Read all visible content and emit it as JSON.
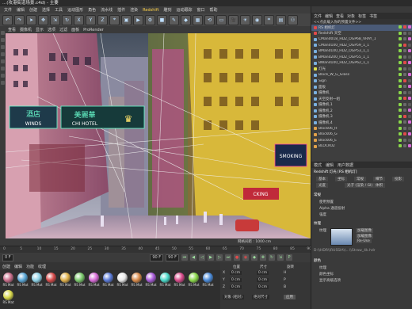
{
  "window": {
    "title": "...(攻港街道场景.c4d) - 主要"
  },
  "menubar": {
    "items": [
      "文件",
      "编辑",
      "创建",
      "选择",
      "工具",
      "运动图形",
      "角色",
      "流水线",
      "插件",
      "渲染",
      "Redshift",
      "雕刻",
      "运动跟踪",
      "窗口",
      "帮助"
    ],
    "highlight_index": 10
  },
  "toolbar": {
    "icons": [
      "undo-icon",
      "redo-icon",
      "select-icon",
      "move-icon",
      "scale-icon",
      "rotate-icon",
      "x-axis-icon",
      "y-axis-icon",
      "z-axis-icon",
      "coord-icon",
      "render-region-icon",
      "render-view-icon",
      "render-settings-icon",
      "cube-icon",
      "pen-icon",
      "subdivision-icon",
      "array-icon",
      "deformer-icon",
      "floor-icon",
      "camera-icon",
      "light-icon",
      "tag-icon",
      "snap-icon",
      "workplane-icon",
      "python-icon"
    ]
  },
  "viewport": {
    "menu": [
      "查看",
      "摄像机",
      "显示",
      "选项",
      "过滤",
      "面板",
      "ProRender"
    ],
    "status": "网格间距 : 1000 cm",
    "signs": {
      "winds": "WINDS",
      "hotel_top": "美麗華",
      "hotel_bottom": "CHI HOTEL",
      "vertical": "酒店",
      "right_sign": "SMOKING",
      "lower_sign": "CKING"
    }
  },
  "timeline": {
    "ticks": [
      "0",
      "5",
      "10",
      "15",
      "20",
      "25",
      "30",
      "35",
      "40",
      "45",
      "50",
      "55",
      "60",
      "65",
      "70",
      "75",
      "80",
      "85",
      "90"
    ],
    "current": "0 F",
    "end": "90 F",
    "frame_field": "0 F"
  },
  "material": {
    "menu": [
      "创建",
      "编辑",
      "功能",
      "纹理"
    ],
    "items": [
      {
        "label": "RS Mat",
        "color": "#c96d8a"
      },
      {
        "label": "RS Mat",
        "color": "#5aa8d8"
      },
      {
        "label": "RS Mat",
        "color": "#8fd3e8"
      },
      {
        "label": "RS Mat",
        "color": "#d64a4a"
      },
      {
        "label": "RS Mat",
        "color": "#e0b04a"
      },
      {
        "label": "RS Mat",
        "color": "#7ac86b"
      },
      {
        "label": "RS Mat",
        "color": "#d86bd8"
      },
      {
        "label": "RS Mat",
        "color": "#5a7ad8"
      },
      {
        "label": "RS Mat",
        "color": "#e8e8e8"
      },
      {
        "label": "RS Mat",
        "color": "#d88a4a"
      },
      {
        "label": "RS Mat",
        "color": "#a85ad8"
      },
      {
        "label": "RS Mat",
        "color": "#4ad8c8"
      },
      {
        "label": "RS Mat",
        "color": "#d84a8a"
      },
      {
        "label": "RS Mat",
        "color": "#8ad84a"
      },
      {
        "label": "RS Mat",
        "color": "#4a8ad8"
      },
      {
        "label": "RS Mat",
        "color": "#d8d84a"
      }
    ]
  },
  "coords": {
    "headers": [
      "位置",
      "尺寸",
      "旋转"
    ],
    "rows": [
      {
        "axis": "X",
        "pos": "0 cm",
        "size": "0 cm",
        "rot": "H"
      },
      {
        "axis": "Y",
        "pos": "0 cm",
        "size": "0 cm",
        "rot": "P"
      },
      {
        "axis": "Z",
        "pos": "0 cm",
        "size": "0 cm",
        "rot": "B"
      }
    ],
    "mode": "对象 (相对)",
    "size_mode": "绝对尺寸",
    "apply": "应用"
  },
  "objects": {
    "tabs": [
      "文件",
      "编辑",
      "查看",
      "对象",
      "标签",
      "书签"
    ],
    "tabs2": [
      "<<点此载入你的预置文件>>"
    ],
    "items": [
      {
        "name": "RS 相机灯",
        "color": "#e04a4a"
      },
      {
        "name": "Redshift 天空",
        "color": "#e04a4a"
      },
      {
        "name": "CMand018_HD2_OGP68_VRAY_1",
        "color": "#7ab0e0"
      },
      {
        "name": "CMand100_HD2_OGP59_1_1",
        "color": "#7ab0e0"
      },
      {
        "name": "BMand100_HD2_OGP53_1_1",
        "color": "#7ab0e0"
      },
      {
        "name": "BMand200_HD2_OGP55_1_1",
        "color": "#7ab0e0"
      },
      {
        "name": "BWand100_HD2_OGP62_1_1",
        "color": "#7ab0e0"
      },
      {
        "name": "灯光",
        "color": "#e0e04a"
      },
      {
        "name": "Block_W_G_Glass",
        "color": "#7ab0e0"
      },
      {
        "name": "Sign",
        "color": "#7ab0e0"
      },
      {
        "name": "面板",
        "color": "#7ab0e0"
      },
      {
        "name": "摄像机",
        "color": "#7ab0e0"
      },
      {
        "name": "天空反射一组",
        "color": "#7ab0e0"
      },
      {
        "name": "摄像机.1",
        "color": "#7ab0e0"
      },
      {
        "name": "摄像机.2",
        "color": "#7ab0e0"
      },
      {
        "name": "摄像机.3",
        "color": "#7ab0e0"
      },
      {
        "name": "摄像机.4",
        "color": "#7ab0e0"
      },
      {
        "name": "Block06_H",
        "color": "#e0a04a"
      },
      {
        "name": "Block06_G",
        "color": "#e0a04a"
      },
      {
        "name": "Block06_E",
        "color": "#e0a04a"
      },
      {
        "name": "BLOCK02",
        "color": "#e0a04a"
      }
    ]
  },
  "attributes": {
    "tabs": [
      "模式",
      "编辑",
      "用户数据"
    ],
    "object_title": "Redshift 灯光 [RS 相机灯]",
    "subtabs": [
      "基本",
      "坐标",
      "常规",
      "细节",
      "投影"
    ],
    "sub2": [
      "光度",
      "光子 (渲染 / GI)",
      "体积"
    ],
    "section1": "常规",
    "opt1": "使用预置",
    "opt2": "Alpha 通道投射",
    "opt3": "强度",
    "section2": "纹理",
    "tex_label": "纹理",
    "tex_btns": [
      "加载图像",
      "加载图像",
      "Re-Use"
    ],
    "path": "D:\\\\HDR\\\\RUSSIA\\\\...\\\\Straw_4k.hdr",
    "section3": "颜色",
    "color_opts": [
      "纹理",
      "颜色坐标",
      "显示高级选项"
    ]
  }
}
